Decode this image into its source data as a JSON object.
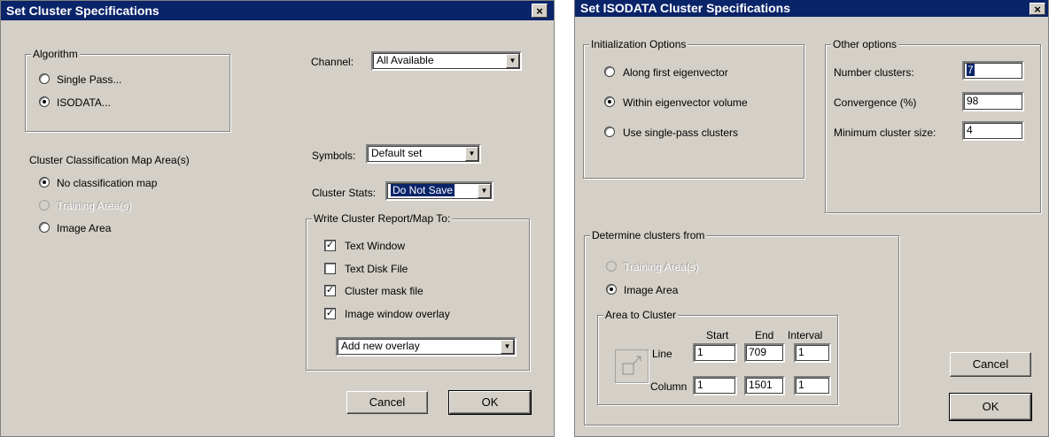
{
  "left_dialog": {
    "title": "Set Cluster Specifications",
    "close_label": "×",
    "algorithm": {
      "legend": "Algorithm",
      "options": [
        "Single Pass...",
        "ISODATA..."
      ],
      "selected": 1
    },
    "channel": {
      "label": "Channel:",
      "value": "All Available"
    },
    "map_area": {
      "label": "Cluster Classification Map Area(s)",
      "options": [
        "No classification map",
        "Training Area(s)",
        "Image Area"
      ],
      "selected": 0,
      "disabled": [
        1
      ]
    },
    "symbols": {
      "label": "Symbols:",
      "value": "Default set"
    },
    "cluster_stats": {
      "label": "Cluster Stats:",
      "value": "Do Not Save"
    },
    "report": {
      "legend": "Write Cluster Report/Map To:",
      "checkboxes": [
        {
          "label": "Text Window",
          "checked": true
        },
        {
          "label": "Text Disk File",
          "checked": false
        },
        {
          "label": "Cluster mask file",
          "checked": true
        },
        {
          "label": "Image window overlay",
          "checked": true
        }
      ],
      "overlay": "Add new overlay"
    },
    "cancel_label": "Cancel",
    "ok_label": "OK"
  },
  "right_dialog": {
    "title": "Set ISODATA Cluster Specifications",
    "close_label": "×",
    "init": {
      "legend": "Initialization Options",
      "options": [
        "Along first eigenvector",
        "Within eigenvector volume",
        "Use single-pass clusters"
      ],
      "selected": 1
    },
    "other": {
      "legend": "Other options",
      "number_clusters": {
        "label": "Number clusters:",
        "value": "7"
      },
      "convergence": {
        "label": "Convergence (%)",
        "value": "98"
      },
      "min_size": {
        "label": "Minimum cluster size:",
        "value": "4"
      }
    },
    "determine": {
      "legend": "Determine clusters from",
      "options": [
        "Training Area(s)",
        "Image Area"
      ],
      "selected": 1,
      "disabled": [
        0
      ]
    },
    "area": {
      "legend": "Area to Cluster",
      "headers": [
        "Start",
        "End",
        "Interval"
      ],
      "line": {
        "label": "Line",
        "start": "1",
        "end": "709",
        "interval": "1"
      },
      "column": {
        "label": "Column",
        "start": "1",
        "end": "1501",
        "interval": "1"
      }
    },
    "cancel_label": "Cancel",
    "ok_label": "OK"
  },
  "icons": {
    "close": "close-icon",
    "dropdown": "chevron-down-icon",
    "area": "area-select-icon"
  },
  "colors": {
    "titlebar": "#0a246a",
    "dialog_bg": "#d4d0c8"
  }
}
